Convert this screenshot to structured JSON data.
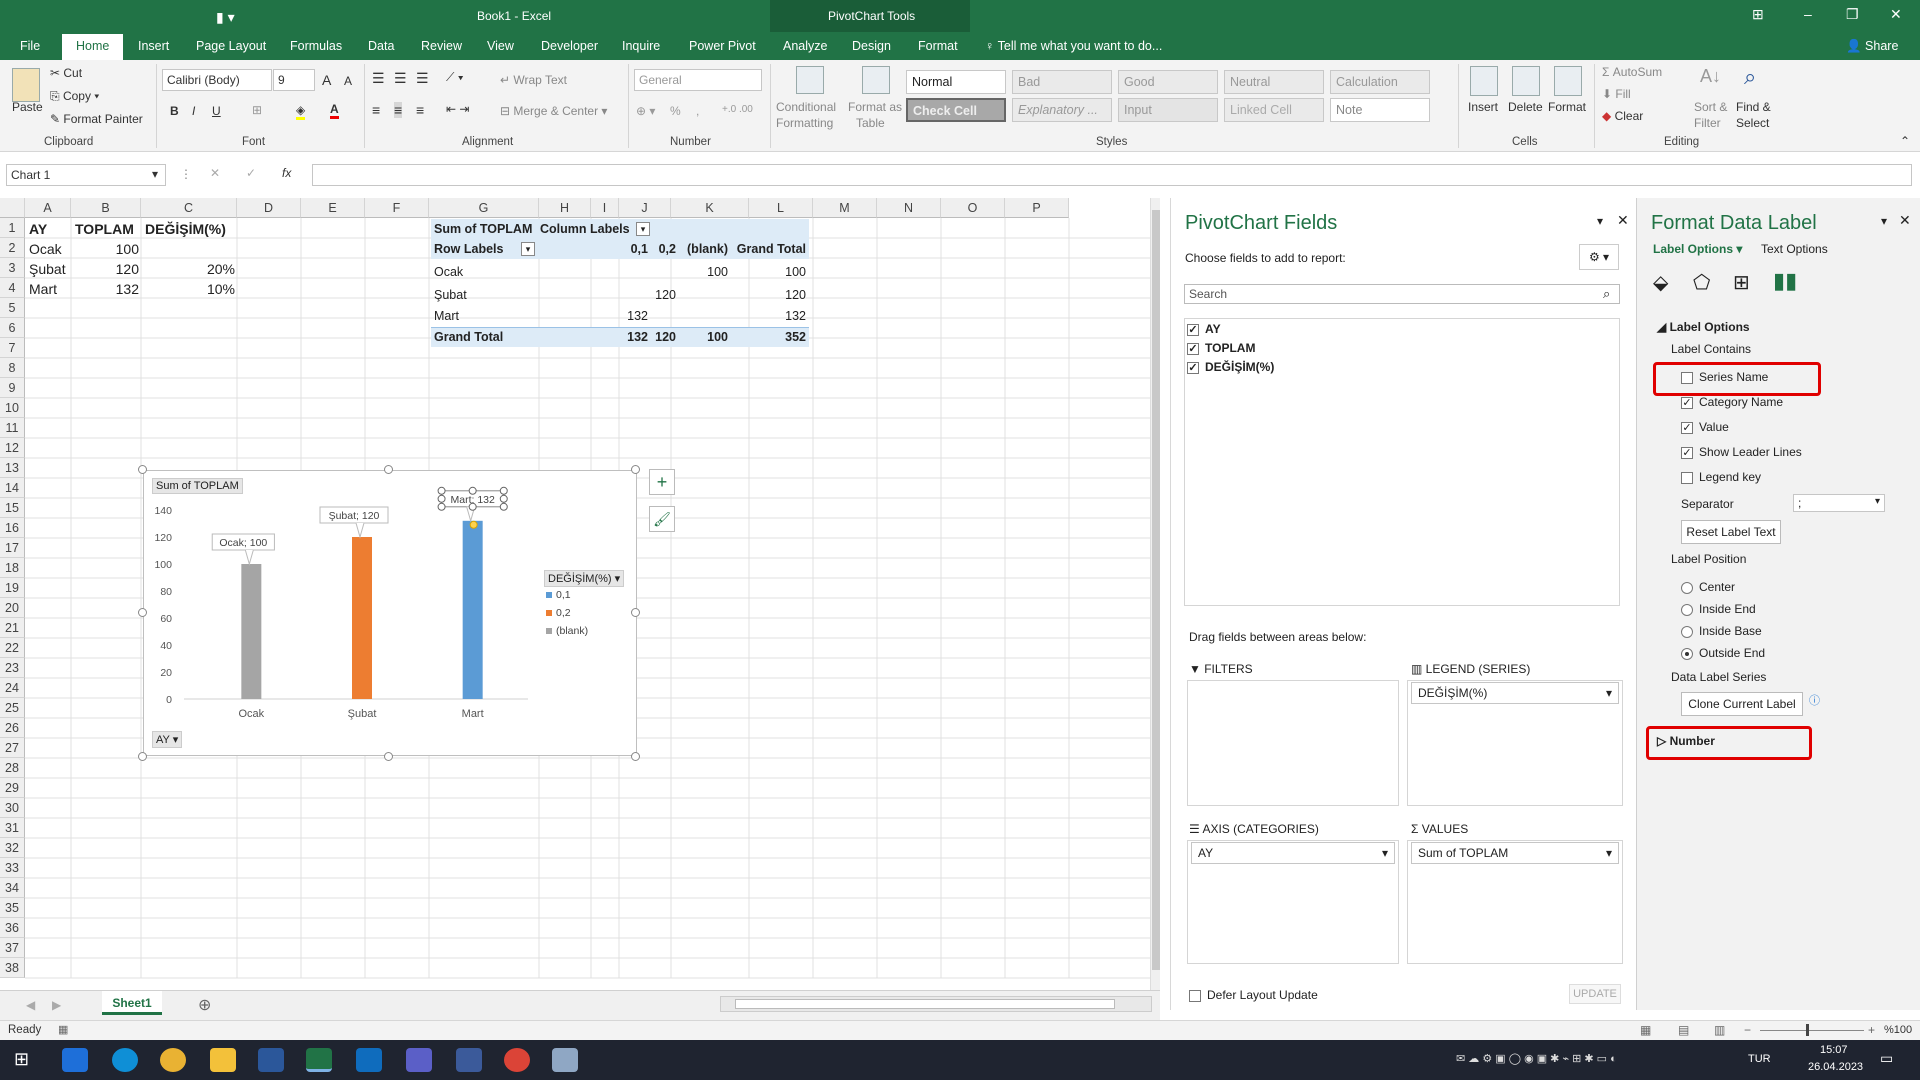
{
  "title": {
    "book": "Book1 - Excel",
    "tools": "PivotChart Tools",
    "share": "Share",
    "ribbon_display": "⊞",
    "minimize": "–",
    "restore": "❐",
    "close": "✕"
  },
  "tabs": [
    "File",
    "Home",
    "Insert",
    "Page Layout",
    "Formulas",
    "Data",
    "Review",
    "View",
    "Developer",
    "Inquire",
    "Power Pivot",
    "Analyze",
    "Design",
    "Format"
  ],
  "tellme": "Tell me what you want to do...",
  "ribbon": {
    "clipboard": {
      "paste": "Paste",
      "cut": "Cut",
      "copy": "Copy",
      "painter": "Format Painter",
      "group": "Clipboard"
    },
    "font": {
      "name": "Calibri (Body)",
      "size": "9",
      "bold": "B",
      "italic": "I",
      "underline": "U",
      "group": "Font"
    },
    "alignment": {
      "wrap": "Wrap Text",
      "merge": "Merge & Center",
      "group": "Alignment"
    },
    "number": {
      "format": "General",
      "group": "Number"
    },
    "styles": {
      "cond1": "Conditional",
      "cond2": "Formatting",
      "fmt1": "Format as",
      "fmt2": "Table",
      "cells": [
        "Normal",
        "Bad",
        "Good",
        "Neutral",
        "Calculation",
        "Check Cell",
        "Explanatory ...",
        "Input",
        "Linked Cell",
        "Note"
      ],
      "group": "Styles"
    },
    "cells": {
      "insert": "Insert",
      "delete": "Delete",
      "format": "Format",
      "group": "Cells"
    },
    "editing": {
      "autosum": "AutoSum",
      "fill": "Fill",
      "clear": "Clear",
      "sort1": "Sort &",
      "sort2": "Filter",
      "find1": "Find &",
      "find2": "Select",
      "group": "Editing"
    }
  },
  "formula_bar": {
    "name_box": "Chart 1",
    "fx": "fx",
    "value": ""
  },
  "columns": [
    "A",
    "B",
    "C",
    "D",
    "E",
    "F",
    "G",
    "H",
    "I",
    "J",
    "K",
    "L",
    "M",
    "N",
    "O",
    "P"
  ],
  "rows": [
    "1",
    "2",
    "3",
    "4",
    "5",
    "6",
    "7",
    "8",
    "9",
    "10",
    "11",
    "12",
    "13",
    "14",
    "15",
    "16",
    "17",
    "18",
    "19",
    "20",
    "21",
    "22",
    "23",
    "24",
    "25",
    "26",
    "27",
    "28",
    "29",
    "30",
    "31",
    "32",
    "33",
    "34",
    "35",
    "36",
    "37",
    "38"
  ],
  "data_table": {
    "headers": [
      "AY",
      "TOPLAM",
      "DEĞİŞİM(%)"
    ],
    "rows": [
      [
        "Ocak",
        "100",
        ""
      ],
      [
        "Şubat",
        "120",
        "20%"
      ],
      [
        "Mart",
        "132",
        "10%"
      ]
    ]
  },
  "pivot": {
    "sum_label": "Sum of TOPLAM",
    "col_labels": "Column Labels",
    "row_labels": "Row Labels",
    "col_heads": [
      "0,1",
      "0,2",
      "(blank)",
      "Grand Total"
    ],
    "rows": [
      {
        "label": "Ocak",
        "v01": "",
        "v02": "",
        "blank": "100",
        "total": "100"
      },
      {
        "label": "Şubat",
        "v01": "",
        "v02": "120",
        "blank": "",
        "total": "120"
      },
      {
        "label": "Mart",
        "v01": "132",
        "v02": "",
        "blank": "",
        "total": "132"
      }
    ],
    "grand": {
      "label": "Grand Total",
      "v01": "132",
      "v02": "120",
      "blank": "100",
      "total": "352"
    }
  },
  "chart_data": {
    "type": "bar",
    "value_field": "Sum of TOPLAM",
    "categories": [
      "Ocak",
      "Şubat",
      "Mart"
    ],
    "series": [
      {
        "name": "0,1",
        "color": "#5b9bd5",
        "values": [
          null,
          null,
          132
        ]
      },
      {
        "name": "0,2",
        "color": "#ed7d31",
        "values": [
          null,
          120,
          null
        ]
      },
      {
        "name": "(blank)",
        "color": "#a5a5a5",
        "values": [
          100,
          null,
          null
        ]
      }
    ],
    "data_labels": [
      "Ocak; 100",
      "Şubat; 120",
      "Mart; 132"
    ],
    "ylim": [
      0,
      140
    ],
    "yticks": [
      "0",
      "20",
      "40",
      "60",
      "80",
      "100",
      "120",
      "140"
    ],
    "legend_title": "DEĞİŞİM(%)",
    "legend_position": "right",
    "axis_field": "AY",
    "grid": false
  },
  "pivot_fields": {
    "title": "PivotChart Fields",
    "choose": "Choose fields to add to report:",
    "search": "Search",
    "fields": [
      {
        "name": "AY",
        "checked": true
      },
      {
        "name": "TOPLAM",
        "checked": true
      },
      {
        "name": "DEĞİŞİM(%)",
        "checked": true
      }
    ],
    "drag": "Drag fields between areas below:",
    "filters": "FILTERS",
    "legend": "LEGEND (SERIES)",
    "legend_value": "DEĞİŞİM(%)",
    "axis": "AXIS (CATEGORIES)",
    "axis_value": "AY",
    "values": "VALUES",
    "values_value": "Sum of TOPLAM",
    "defer": "Defer Layout Update",
    "update": "UPDATE"
  },
  "format_panel": {
    "title": "Format Data Label",
    "tab1": "Label Options",
    "tab2": "Text Options",
    "section": "Label Options",
    "contains": "Label Contains",
    "checks": [
      {
        "label": "Series Name",
        "checked": false
      },
      {
        "label": "Category Name",
        "checked": true
      },
      {
        "label": "Value",
        "checked": true
      },
      {
        "label": "Show Leader Lines",
        "checked": true
      },
      {
        "label": "Legend key",
        "checked": false
      }
    ],
    "separator": "Separator",
    "separator_value": ";",
    "reset": "Reset Label Text",
    "position": "Label Position",
    "positions": [
      {
        "label": "Center",
        "on": false
      },
      {
        "label": "Inside End",
        "on": false
      },
      {
        "label": "Inside Base",
        "on": false
      },
      {
        "label": "Outside End",
        "on": true
      }
    ],
    "series_label": "Data Label Series",
    "clone": "Clone Current Label",
    "number": "Number"
  },
  "sheet_tab": "Sheet1",
  "status": {
    "ready": "Ready",
    "zoom": "%100"
  },
  "taskbar": {
    "lang": "TUR",
    "time": "15:07",
    "date": "26.04.2023"
  }
}
